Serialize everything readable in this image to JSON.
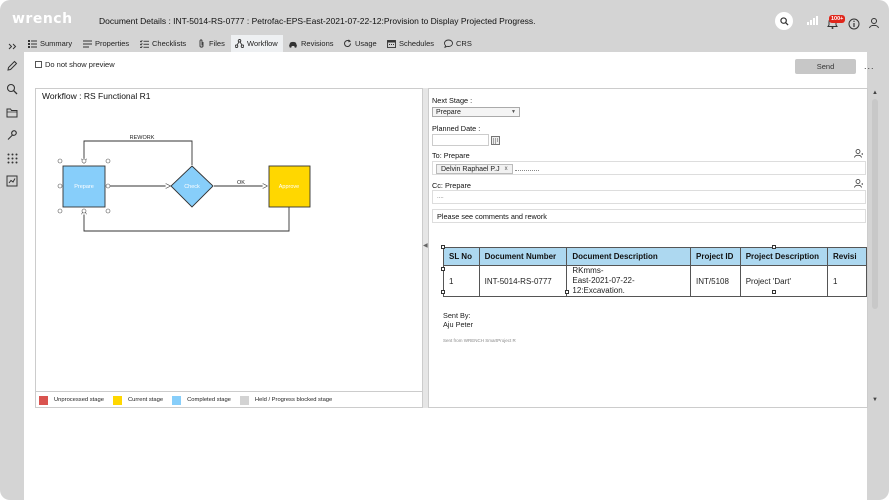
{
  "app": {
    "logo": "wrench"
  },
  "header": {
    "title": "Document Details : INT-5014-RS-0777 : Petrofac-EPS-East-2021-07-22-12:Provision to Display Projected Progress.",
    "notification_count": "100+"
  },
  "tabs": [
    {
      "label": "Summary",
      "icon": "summary-icon"
    },
    {
      "label": "Properties",
      "icon": "properties-icon"
    },
    {
      "label": "Checklists",
      "icon": "checklist-icon"
    },
    {
      "label": "Files",
      "icon": "paperclip-icon"
    },
    {
      "label": "Workflow",
      "icon": "workflow-icon",
      "active": true
    },
    {
      "label": "Revisions",
      "icon": "revisions-icon"
    },
    {
      "label": "Usage",
      "icon": "usage-icon"
    },
    {
      "label": "Schedules",
      "icon": "calendar-icon"
    },
    {
      "label": "CRS",
      "icon": "comment-icon"
    }
  ],
  "toolbar": {
    "preview_label": "Do not show preview",
    "send_label": "Send",
    "more_label": "..."
  },
  "workflow": {
    "title": "Workflow : RS Functional R1",
    "nodes": {
      "prepare": "Prepare",
      "check": "Check",
      "approve": "Approve"
    },
    "edges": {
      "rework": "REWORK",
      "ok": "OK"
    },
    "legend": [
      {
        "label": "Unprocessed stage",
        "color": "#d9534f"
      },
      {
        "label": "Current stage",
        "color": "#ffd700"
      },
      {
        "label": "Completed stage",
        "color": "#87cefa"
      },
      {
        "label": "Held / Progress blocked stage",
        "color": "#d3d3d3"
      }
    ]
  },
  "form": {
    "next_stage_label": "Next Stage :",
    "next_stage_value": "Prepare",
    "planned_date_label": "Planned Date :",
    "to_label": "To: Prepare",
    "to_recipient": "Delvin Raphael P.J",
    "cc_label": "Cc: Prepare",
    "cc_placeholder": "....",
    "comment": "Please see comments and rework"
  },
  "table": {
    "headers": [
      "SL No",
      "Document Number",
      "Document Description",
      "Project ID",
      "Project Description",
      "Revisi"
    ],
    "rows": [
      [
        "1",
        "INT-5014-RS-0777",
        "RKmms-\nEast-2021-07-22-12:Excavation.",
        "INT/5108",
        "Project 'Dart'",
        "1"
      ]
    ]
  },
  "message": {
    "sent_by_label": "Sent By:",
    "sender": "Aju Peter",
    "footer": "Sent from WRENCH SmartProject R"
  },
  "colors": {
    "chrome": "#d4d4d4",
    "completed": "#87cefa",
    "current": "#ffd700",
    "check": "#87cefa",
    "table_header": "#add8f0",
    "badge": "#e0261b"
  }
}
